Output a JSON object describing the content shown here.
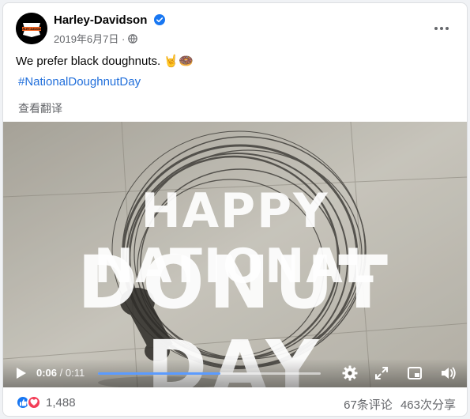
{
  "post": {
    "page_name": "Harley-Davidson",
    "date": "2019年6月7日",
    "privacy_icon": "globe-icon",
    "text": "We prefer black doughnuts.",
    "emoji": "🤘🍩",
    "hashtag": "#NationalDoughnutDay",
    "translate_label": "查看翻译"
  },
  "logo": {
    "line1": "HARLEY-DAVIDSON"
  },
  "video": {
    "overlay_line1": "HAPPY NATIONAL",
    "overlay_line2": "DONUT DAY",
    "current_time": "0:06",
    "separator": " / ",
    "duration": "0:11",
    "progress_fraction": 0.55
  },
  "footer": {
    "reaction_count": "1,488",
    "comments": "67条评论",
    "shares": "463次分享"
  },
  "colors": {
    "accent": "#1877f2",
    "hashtag": "#216fdb",
    "progress": "#5b9bff",
    "love": "#f33e58"
  }
}
